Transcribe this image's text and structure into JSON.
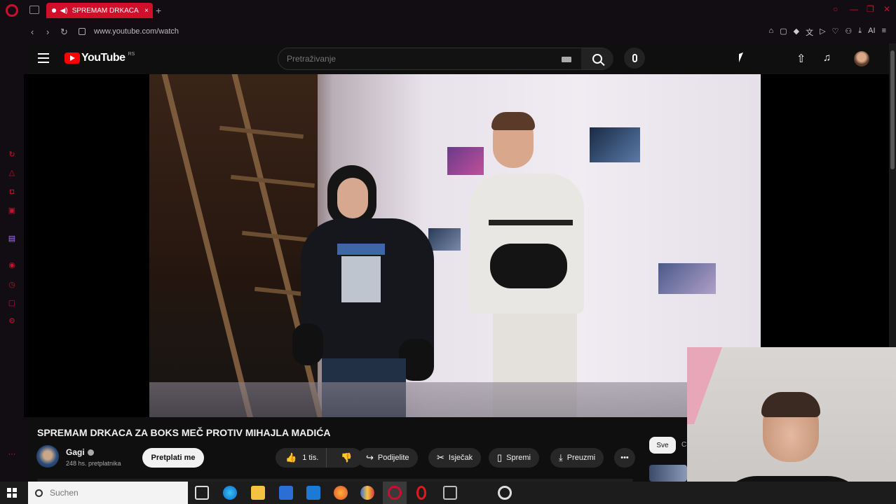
{
  "browser": {
    "tab_title": "SPREMAM DRKACA Z",
    "tab_close": "×",
    "new_tab": "+",
    "url": "www.youtube.com/watch",
    "ai_label": "AI",
    "window_controls": [
      "—",
      "❐",
      "✕"
    ]
  },
  "youtube": {
    "logo_text": "YouTube",
    "country_code": "RS",
    "search_placeholder": "Pretraživanje"
  },
  "video": {
    "title": "SPREMAM DRKACA ZA BOKS MEČ PROTIV MIHAJLA MADIĆA",
    "channel_name": "Gagi",
    "subscribers": "248 hs. pretplatnika",
    "subscribe_label": "Pretplati me",
    "likes": "1 tis.",
    "share_label": "Podijelite",
    "clip_label": "Isječak",
    "save_label": "Spremi",
    "download_label": "Preuzmi",
    "more_label": "•••"
  },
  "side": {
    "chip_all": "Sve",
    "chip_next": "C"
  },
  "taskbar": {
    "search_placeholder": "Suchen"
  },
  "icons": {
    "upload": "⇧",
    "bell": "🔔",
    "like": "👍",
    "dislike": "👎",
    "share": "↪",
    "clip": "✂",
    "save": "🔖",
    "download": "⤓"
  },
  "colors": {
    "opera_red": "#c8102e",
    "youtube_red": "#ff0000",
    "background": "#0f0f0f"
  }
}
